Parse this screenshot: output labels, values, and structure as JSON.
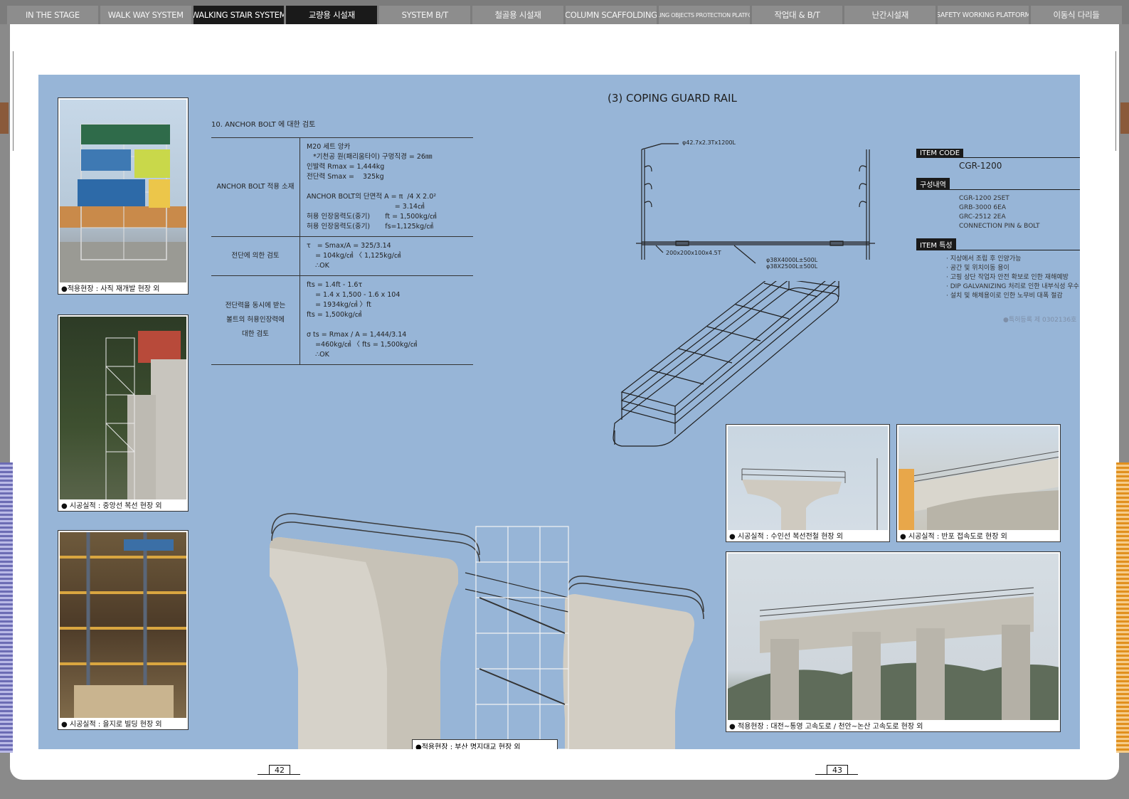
{
  "nav": {
    "tabs": [
      {
        "label": "IN THE STAGE",
        "active": false
      },
      {
        "label": "WALK WAY SYSTEM",
        "active": false
      },
      {
        "label": "WALKING STAIR SYSTEM",
        "active": true
      },
      {
        "label": "교량용 시설재",
        "active": true
      },
      {
        "label": "SYSTEM B/T",
        "active": false
      },
      {
        "label": "철골용 시설재",
        "active": false
      },
      {
        "label": "COLUMN SCAFFOLDING",
        "active": false
      },
      {
        "label": "FALLING OBJECTS PROTECTION PLATFORM",
        "active": false
      },
      {
        "label": "작업대 & B/T",
        "active": false
      },
      {
        "label": "난간시설재",
        "active": false
      },
      {
        "label": "SAFETY WORKING PLATFORM",
        "active": false
      },
      {
        "label": "이동식 다리들",
        "active": false
      }
    ]
  },
  "left_photos": [
    {
      "caption": "●적용현장 : 사직 재개발 현장 외"
    },
    {
      "caption": "● 시공실적 : 중앙선 복선 현장 외"
    },
    {
      "caption": "● 시공실적 : 을지로 빌딩 현장 외"
    }
  ],
  "anchor_review": {
    "title": "10. ANCHOR BOLT 에 대한 검토",
    "rows": [
      {
        "label": "ANCHOR BOLT 적용 소재",
        "value": "M20 세트 앙카\n   *기천공 원(패리움타이) 구멍직경 = 26㎜\n인발력 Rmax = 1,444kg\n전단력 Smax =    325kg\n\nANCHOR BOLT의 단면적 A = π  /4 X 2.0²\n                                         = 3.14㎠\n허용 인장응력도(중기)       ft = 1,500kg/㎠\n허용 인장응력도(중기)       fs=1,125kg/㎠"
      },
      {
        "label": "전단에 의한 검토",
        "value": "τ   = Smax/A = 325/3.14\n    = 104kg/㎠ 〈 1,125kg/㎠\n    ∴OK"
      },
      {
        "label": "전단력을 동시에 받는\n볼트의 허용인장력에\n대한 검토",
        "value": "fts = 1.4ft - 1.6τ\n    = 1.4 x 1,500 - 1.6 x 104\n    = 1934kg/㎠ 〉ft\nfts = 1,500kg/㎠\n\nσ ts = Rmax / A = 1,444/3.14\n    =460kg/㎠ 〈 fts = 1,500kg/㎠\n    ∴OK"
      }
    ]
  },
  "center_photo_caption": "●적용현장 : 부산 명지대교 현장 외",
  "guard_rail": {
    "title": "(3) COPING GUARD RAIL",
    "dim_pipe": "φ42.7x2.3Tx1200L",
    "dim_plate": "200x200x100x4.5T",
    "dim_rail_1": "φ38X4000L±500L",
    "dim_rail_2": "φ38X2500L±500L"
  },
  "spec": {
    "item_code_label": "ITEM CODE",
    "item_code": "CGR-1200",
    "composition_label": "구성내역",
    "composition": [
      "CGR-1200 2SET",
      "GRB-3000 6EA",
      "GRC-2512 2EA",
      "CONNECTION PIN & BOLT"
    ],
    "feature_label": "ITEM 특성",
    "features": [
      "· 지상에서 조립 후 인양가능",
      "· 공간 및 위치이동 용이",
      "· 고핑 상단 작업자 안전 확보로 인한 재해예방",
      "· DIP GALVANIZING 처리로 인한 내부식성 우수",
      "· 설치 및 해체용이로 인한 노무비 대폭 절감"
    ],
    "patent": "●특허등록 제 0302136호"
  },
  "right_photos": [
    {
      "caption": "● 시공실적 : 수인선 복선전철 현장 외"
    },
    {
      "caption": "● 시공실적 : 반포 접속도로 현장 외"
    },
    {
      "caption": "● 적용현장 : 대전~통영 고속도로 / 천안~논산 고속도로 현장 외"
    }
  ],
  "pages": {
    "left": "42",
    "right": "43"
  },
  "colors": {
    "background_blue": "#97b5d7",
    "nav_gray": "#8d8d8d",
    "nav_active": "#1a1a1a"
  }
}
